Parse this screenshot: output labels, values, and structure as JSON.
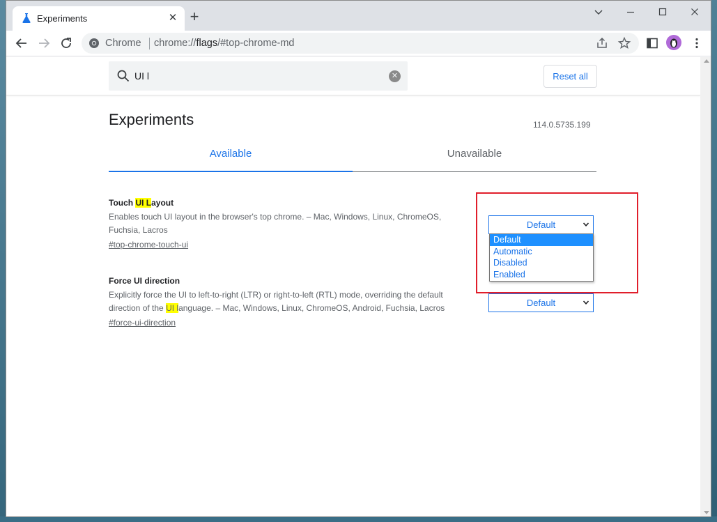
{
  "browser": {
    "tab_title": "Experiments",
    "new_tab_glyph": "+",
    "tab_close_glyph": "✕",
    "window_controls": [
      "chevron-down-icon",
      "minimize-icon",
      "maximize-icon",
      "close-icon"
    ],
    "omnibox": {
      "scheme_label": "Chrome",
      "url_prefix": "chrome://",
      "url_host": "flags",
      "url_suffix": "/#top-chrome-md"
    }
  },
  "page": {
    "search": {
      "value": "UI l"
    },
    "reset_label": "Reset all",
    "title": "Experiments",
    "version": "114.0.5735.199",
    "tabs": [
      {
        "label": "Available",
        "active": true
      },
      {
        "label": "Unavailable",
        "active": false
      }
    ],
    "experiments": [
      {
        "name_pre": "Touch ",
        "name_hl": "UI L",
        "name_post": "ayout",
        "desc_line1": "Enables touch UI layout in the browser's top chrome. – Mac, Windows, Linux, ChromeOS,",
        "desc_line2_pre": "Fuchsia, Lacros",
        "desc_line2_hl": "",
        "desc_line2_post": "",
        "link": "#top-chrome-touch-ui",
        "select_value": "Default",
        "dropdown_open": true,
        "options": [
          "Default",
          "Automatic",
          "Disabled",
          "Enabled"
        ],
        "selected_option": 0
      },
      {
        "name_pre": "Force UI direction",
        "name_hl": "",
        "name_post": "",
        "desc_line1": "Explicitly force the UI to left-to-right (LTR) or right-to-left (RTL) mode, overriding the default",
        "desc_line2_pre": "direction of the ",
        "desc_line2_hl": "UI l",
        "desc_line2_post": "anguage. – Mac, Windows, Linux, ChromeOS, Android, Fuchsia, Lacros",
        "link": "#force-ui-direction",
        "select_value": "Default"
      }
    ]
  },
  "colors": {
    "accent": "#1a73e8",
    "highlight": "#ffff00",
    "annotation": "#e01e2b",
    "selected_option_bg": "#1e90ff"
  }
}
